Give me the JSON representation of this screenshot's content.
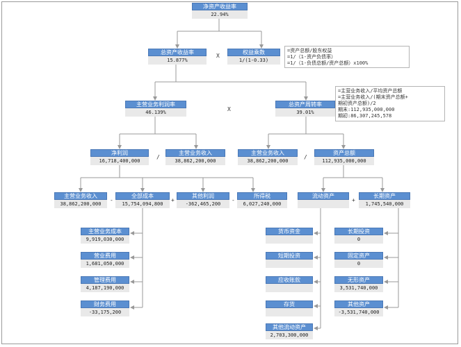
{
  "nodes": {
    "roe": {
      "label": "净资产收益率",
      "value": "22.94%"
    },
    "roa": {
      "label": "总资产收益率",
      "value": "15.877%"
    },
    "equity_multiplier": {
      "label": "权益乘数",
      "value": "1/(1-0.33)"
    },
    "net_margin": {
      "label": "主营业务利润率",
      "value": "46.139%"
    },
    "asset_turnover": {
      "label": "总资产周转率",
      "value": "39.01%"
    },
    "net_profit": {
      "label": "净利润",
      "value": "16,718,400,000"
    },
    "revenue_a": {
      "label": "主营业务收入",
      "value": "38,862,200,000"
    },
    "revenue_b": {
      "label": "主营业务收入",
      "value": "38,862,200,000"
    },
    "total_assets": {
      "label": "资产总额",
      "value": "112,935,000,000"
    },
    "revenue_c": {
      "label": "主营业务收入",
      "value": "38,862,200,000"
    },
    "total_cost": {
      "label": "全部成本",
      "value": "15,754,094,800"
    },
    "other_profit": {
      "label": "其他利润",
      "value": "-362,465,200"
    },
    "income_tax": {
      "label": "所得税",
      "value": "6,027,240,000"
    },
    "current_assets": {
      "label": "流动资产",
      "value": ""
    },
    "long_term_assets": {
      "label": "长期资产",
      "value": "1,745,540,000"
    },
    "cogs": {
      "label": "主营业务成本",
      "value": "9,919,030,000"
    },
    "selling_exp": {
      "label": "营业费用",
      "value": "1,681,050,000"
    },
    "admin_exp": {
      "label": "管理费用",
      "value": "4,187,190,000"
    },
    "finance_exp": {
      "label": "财务费用",
      "value": "-33,175,200"
    },
    "cash": {
      "label": "货币资金",
      "value": ""
    },
    "st_invest": {
      "label": "短期投资",
      "value": ""
    },
    "receivables": {
      "label": "应收账款",
      "value": ""
    },
    "inventory": {
      "label": "存货",
      "value": ""
    },
    "other_current": {
      "label": "其他流动资产",
      "value": "2,703,300,000"
    },
    "lt_invest": {
      "label": "长期投资",
      "value": "0"
    },
    "fixed_assets": {
      "label": "固定资产",
      "value": "0"
    },
    "intangible": {
      "label": "无形资产",
      "value": "3,531,740,000"
    },
    "other_assets": {
      "label": "其他资产",
      "value": "-3,531,740,000"
    }
  },
  "operators": {
    "x1": "X",
    "x2": "X",
    "div1": "/",
    "div2": "/",
    "minus": "-",
    "plus1": "+",
    "minus2": "-",
    "plus2": "+"
  },
  "notes": {
    "equity": "=资产总额/股东权益\n=1/（1-资产负债率）\n=1/（1-负债总额/资产总额）x100%",
    "turnover": "=主营业务收入/平均资产总额\n=主营业务收入/(期末资产总额+\n期初资产总额)/2\n期末:112,935,000,000\n期初:86,307,245,578"
  },
  "colors": {
    "header": "#5b8fd1",
    "value_bg": "#e9e9e9",
    "line": "#999999"
  }
}
